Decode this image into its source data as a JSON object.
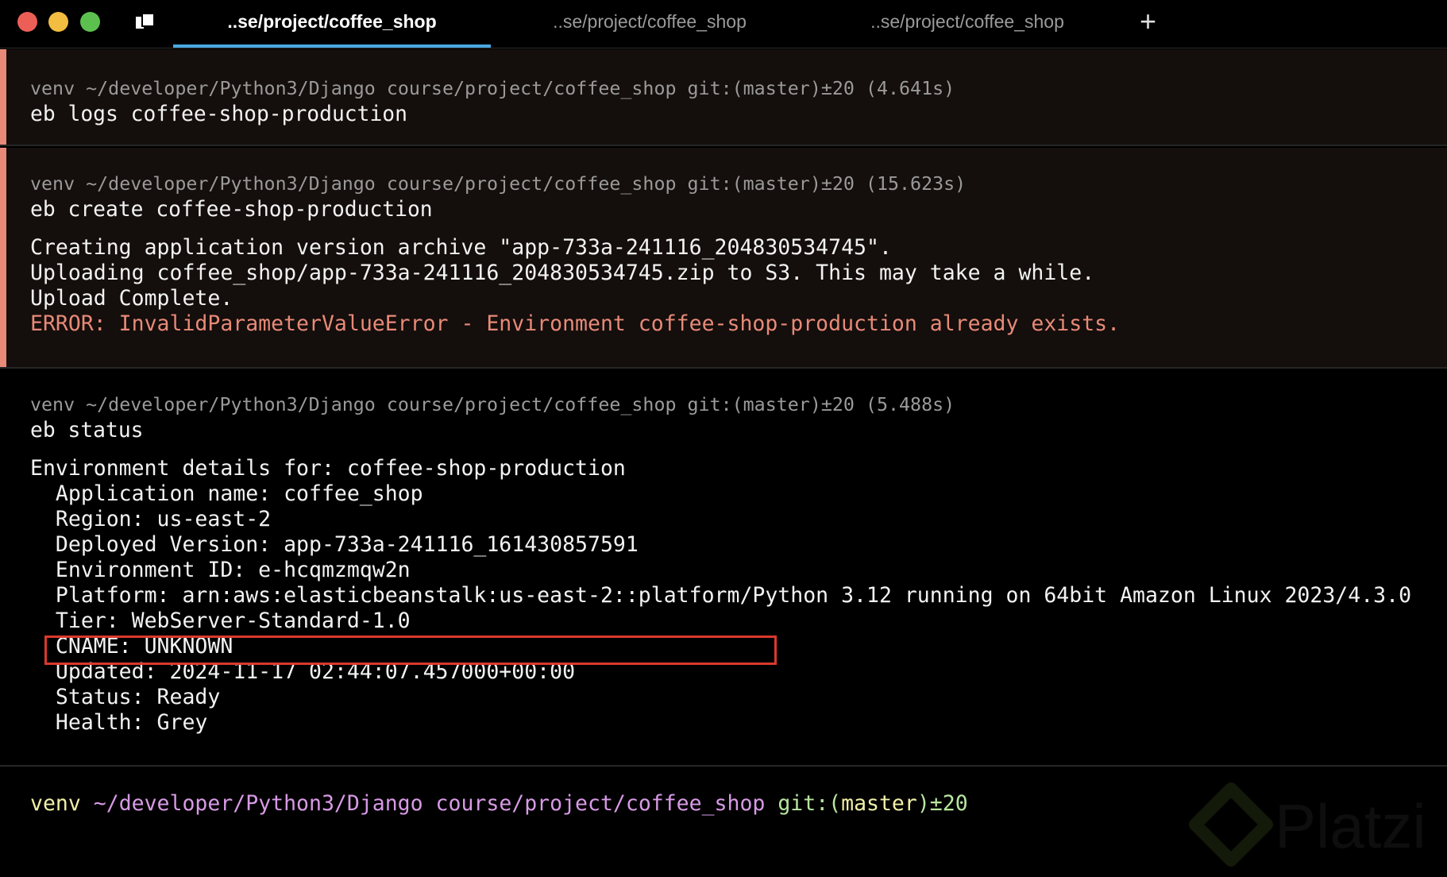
{
  "tabs": [
    {
      "label": "..se/project/coffee_shop"
    },
    {
      "label": "..se/project/coffee_shop"
    },
    {
      "label": "..se/project/coffee_shop"
    }
  ],
  "new_tab": "+",
  "blocks": [
    {
      "prompt": "venv ~/developer/Python3/Django course/project/coffee_shop git:(master)±20 (4.641s)",
      "command": "eb logs coffee-shop-production",
      "output": []
    },
    {
      "prompt": "venv ~/developer/Python3/Django course/project/coffee_shop git:(master)±20 (15.623s)",
      "command": "eb create coffee-shop-production",
      "output": [
        "Creating application version archive \"app-733a-241116_204830534745\".",
        "Uploading coffee_shop/app-733a-241116_204830534745.zip to S3. This may take a while.",
        "Upload Complete."
      ],
      "error": "ERROR: InvalidParameterValueError - Environment coffee-shop-production already exists."
    },
    {
      "prompt": "venv ~/developer/Python3/Django course/project/coffee_shop git:(master)±20 (5.488s)",
      "command": "eb status",
      "output": [
        "Environment details for: coffee-shop-production",
        "  Application name: coffee_shop",
        "  Region: us-east-2",
        "  Deployed Version: app-733a-241116_161430857591",
        "  Environment ID: e-hcqmzmqw2n",
        "  Platform: arn:aws:elasticbeanstalk:us-east-2::platform/Python 3.12 running on 64bit Amazon Linux 2023/4.3.0",
        "  Tier: WebServer-Standard-1.0",
        "  CNAME: UNKNOWN",
        "  Updated: 2024-11-17 02:44:07.457000+00:00",
        "  Status: Ready",
        "  Health: Grey"
      ]
    }
  ],
  "current_prompt": {
    "venv": "venv ",
    "path": "~/developer/Python3/Django course/project/coffee_shop",
    "git": " git:(",
    "branch": "master",
    "git_end": ")±20"
  },
  "watermark": "Platzi",
  "colors": {
    "venv": "#f0f0a8",
    "path": "#d89ae6",
    "git": "#b8e6a0",
    "error": "#e88a78",
    "tab_active": "#4aa8e0",
    "highlight_box": "#d9392c"
  }
}
